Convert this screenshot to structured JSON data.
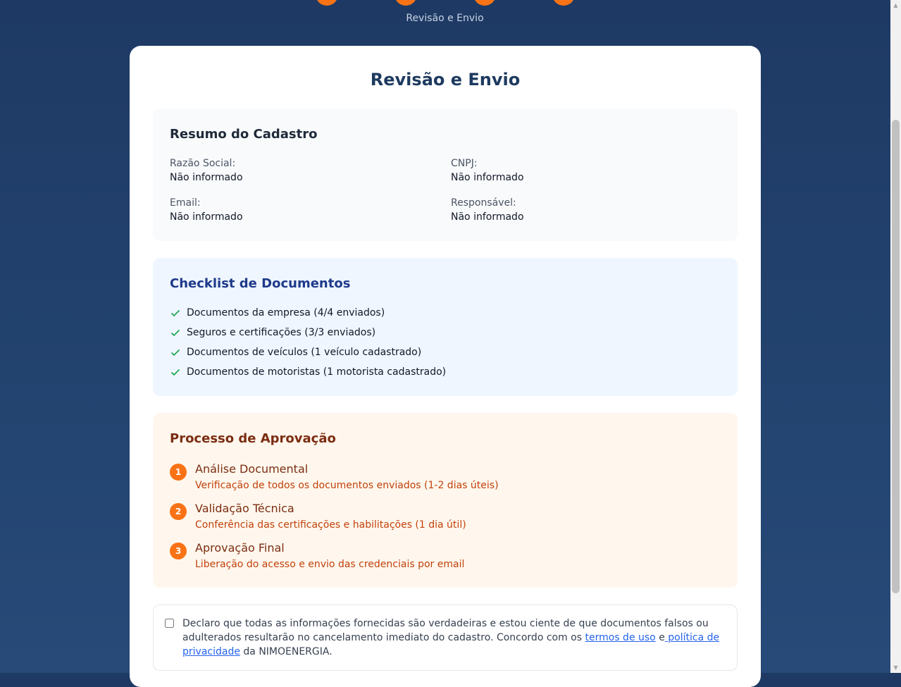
{
  "stepper": {
    "current_label": "Revisão e Envio"
  },
  "card": {
    "title": "Revisão e Envio"
  },
  "summary": {
    "title": "Resumo do Cadastro",
    "fields": [
      {
        "label": "Razão Social:",
        "value": "Não informado"
      },
      {
        "label": "CNPJ:",
        "value": "Não informado"
      },
      {
        "label": "Email:",
        "value": "Não informado"
      },
      {
        "label": "Responsável:",
        "value": "Não informado"
      }
    ]
  },
  "checklist": {
    "title": "Checklist de Documentos",
    "items": [
      {
        "text": "Documentos da empresa (4/4 enviados)",
        "icon": "check-icon"
      },
      {
        "text": "Seguros e certificações (3/3 enviados)",
        "icon": "check-icon"
      },
      {
        "text": "Documentos de veículos (1 veículo cadastrado)",
        "icon": "check-icon"
      },
      {
        "text": "Documentos de motoristas (1 motorista cadastrado)",
        "icon": "check-icon"
      }
    ]
  },
  "approval": {
    "title": "Processo de Aprovação",
    "steps": [
      {
        "number": "1",
        "title": "Análise Documental",
        "description": "Verificação de todos os documentos enviados (1-2 dias úteis)"
      },
      {
        "number": "2",
        "title": "Validação Técnica",
        "description": "Conferência das certificações e habilitações (1 dia útil)"
      },
      {
        "number": "3",
        "title": "Aprovação Final",
        "description": "Liberação do acesso e envio das credenciais por email"
      }
    ]
  },
  "declaration": {
    "checked": false,
    "text_before": "Declaro que todas as informações fornecidas são verdadeiras e estou ciente de que documentos falsos ou adulterados resultarão no cancelamento imediato do cadastro. Concordo com os ",
    "terms_link": "termos de uso",
    "connector": " e",
    "privacy_link": " política de privacidade",
    "text_after": " da NIMOENERGIA."
  },
  "colors": {
    "accent": "#f97316",
    "background": "#1e3a64",
    "check": "#16a34a",
    "link": "#2563eb"
  }
}
